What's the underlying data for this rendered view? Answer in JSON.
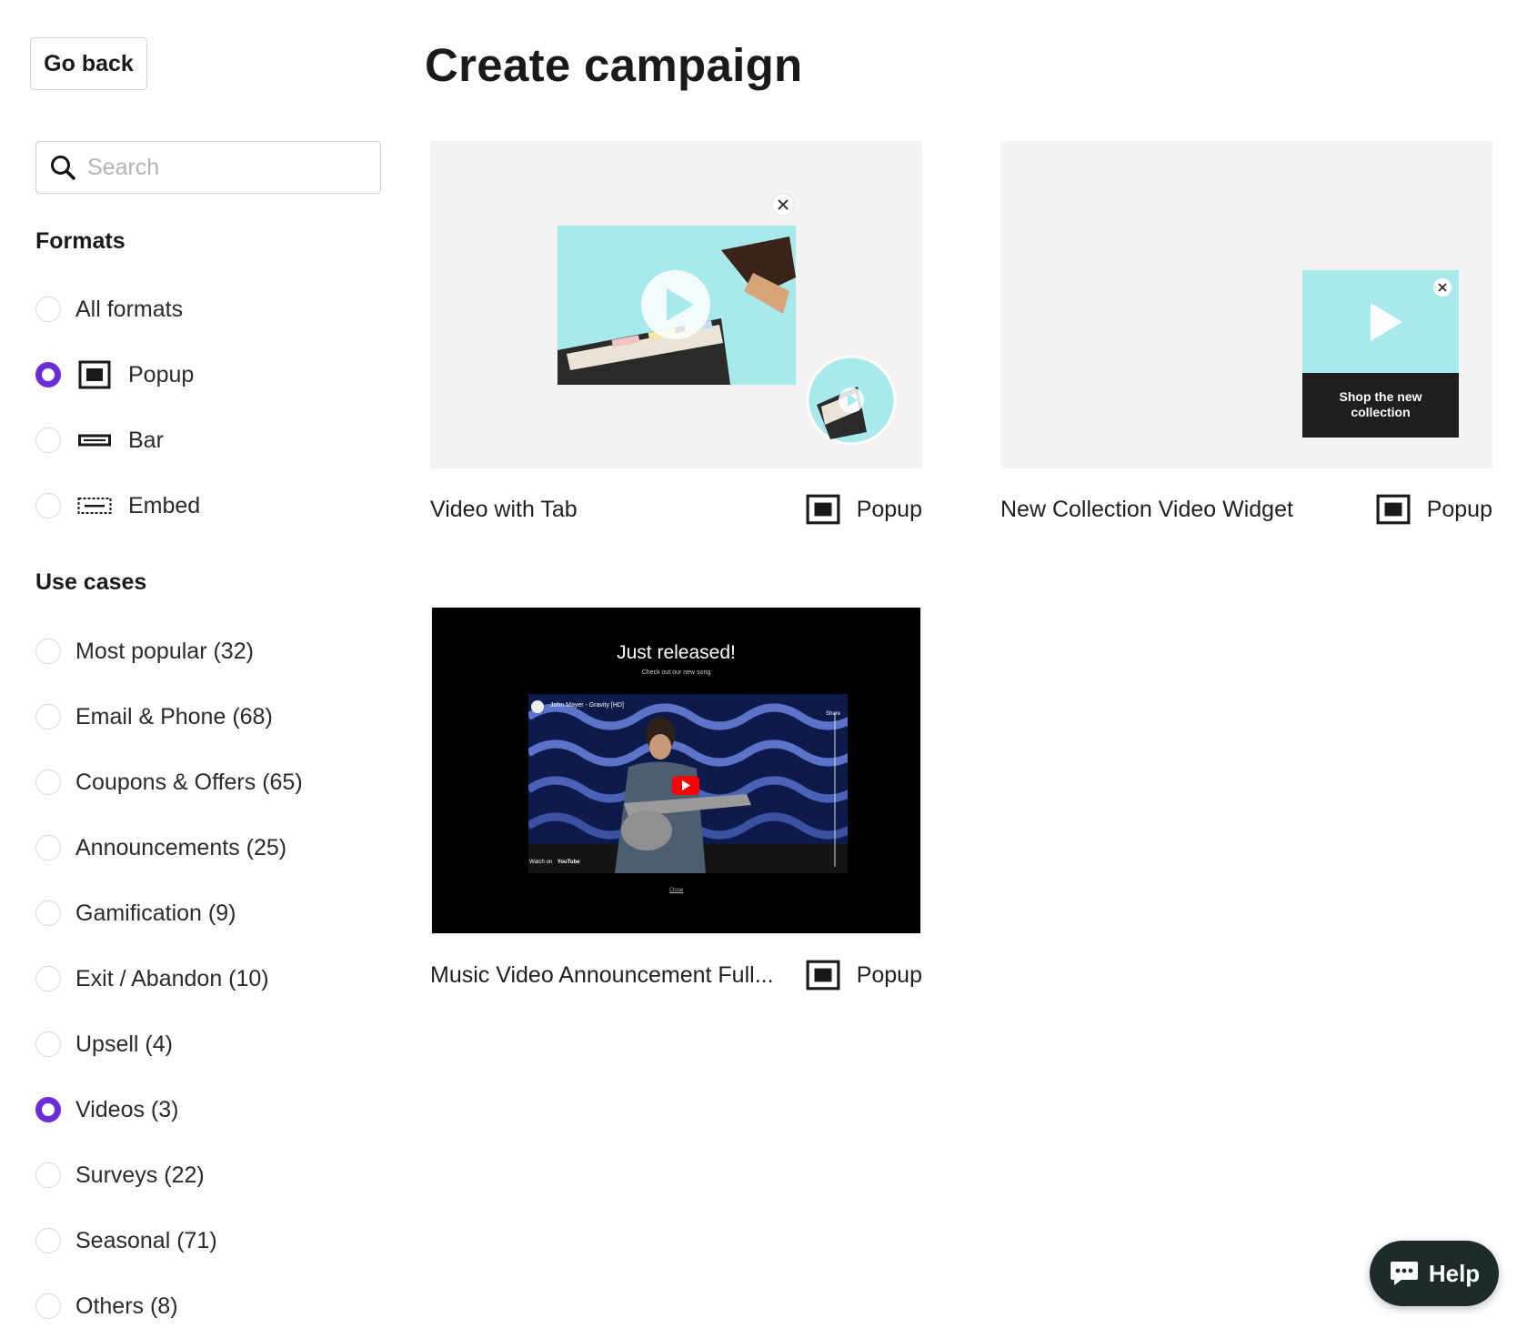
{
  "header": {
    "back_label": "Go back",
    "title": "Create campaign"
  },
  "search": {
    "placeholder": "Search",
    "value": ""
  },
  "formats": {
    "title": "Formats",
    "items": [
      {
        "label": "All formats",
        "icon": "none",
        "checked": false
      },
      {
        "label": "Popup",
        "icon": "popup-icon",
        "checked": true
      },
      {
        "label": "Bar",
        "icon": "bar-icon",
        "checked": false
      },
      {
        "label": "Embed",
        "icon": "embed-icon",
        "checked": false
      }
    ]
  },
  "use_cases": {
    "title": "Use cases",
    "items": [
      {
        "label": "Most popular (32)",
        "checked": false
      },
      {
        "label": "Email & Phone (68)",
        "checked": false
      },
      {
        "label": "Coupons & Offers (65)",
        "checked": false
      },
      {
        "label": "Announcements (25)",
        "checked": false
      },
      {
        "label": "Gamification (9)",
        "checked": false
      },
      {
        "label": "Exit / Abandon (10)",
        "checked": false
      },
      {
        "label": "Upsell (4)",
        "checked": false
      },
      {
        "label": "Videos (3)",
        "checked": true
      },
      {
        "label": "Surveys (22)",
        "checked": false
      },
      {
        "label": "Seasonal (71)",
        "checked": false
      },
      {
        "label": "Others (8)",
        "checked": false
      }
    ]
  },
  "templates": [
    {
      "name": "Video with Tab",
      "type": "Popup"
    },
    {
      "name": "New Collection Video Widget",
      "type": "Popup",
      "thumb_caption": "Shop the new collection"
    },
    {
      "name": "Music Video Announcement Full...",
      "type": "Popup",
      "thumb_heading": "Just released!",
      "thumb_subheading": "Check out our new song",
      "thumb_video_title": "John Mayer - Gravity [HD]",
      "thumb_share": "Share",
      "thumb_watch_on": "Watch on",
      "thumb_platform": "YouTube",
      "thumb_close": "Close"
    }
  ],
  "help": {
    "label": "Help"
  },
  "colors": {
    "accent": "#6b2bd9",
    "help_bg": "#1e2b2b",
    "thumb_bg": "#f3f3f3",
    "cyan": "#a8e9ec"
  }
}
